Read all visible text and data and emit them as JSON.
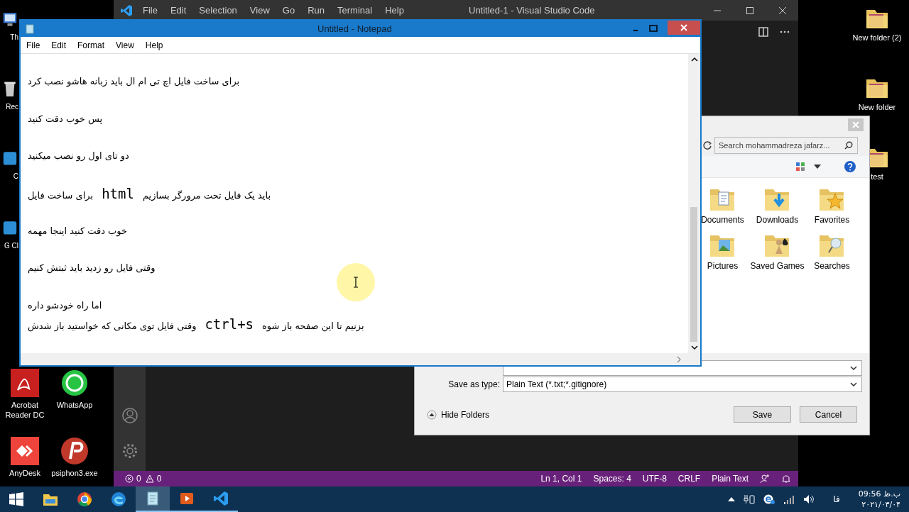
{
  "desktop": {
    "left_icons": [
      {
        "label": "Th",
        "kind": "computer"
      },
      {
        "label": "Rec",
        "kind": "bin"
      },
      {
        "label": "C",
        "kind": "app"
      },
      {
        "label": "G Cl",
        "kind": "app"
      }
    ],
    "bottom_icons": [
      {
        "label": "Acrobat Reader DC",
        "kind": "acrobat"
      },
      {
        "label": "WhatsApp",
        "kind": "whatsapp"
      },
      {
        "label": "AnyDesk",
        "kind": "anydesk"
      },
      {
        "label": "psiphon3.exe",
        "kind": "psiphon"
      }
    ],
    "right_icons": [
      {
        "label": "New folder (2)",
        "kind": "folder"
      },
      {
        "label": "New folder",
        "kind": "folder"
      },
      {
        "label": "test",
        "kind": "folder"
      }
    ]
  },
  "vscode": {
    "menu": [
      "File",
      "Edit",
      "Selection",
      "View",
      "Go",
      "Run",
      "Terminal",
      "Help"
    ],
    "title": "Untitled-1 - Visual Studio Code",
    "status_left": [
      {
        "kind": "error",
        "count": "0"
      },
      {
        "kind": "warning",
        "count": "0"
      }
    ],
    "status_right": [
      "Ln 1, Col 1",
      "Spaces: 4",
      "UTF-8",
      "CRLF",
      "Plain Text"
    ]
  },
  "save_dialog": {
    "search": {
      "placeholder": "Search mohammadreza jafarz..."
    },
    "folders": [
      {
        "label": "Documents",
        "kind": "documents"
      },
      {
        "label": "Downloads",
        "kind": "downloads"
      },
      {
        "label": "Favorites",
        "kind": "favorites"
      },
      {
        "label": "Pictures",
        "kind": "pictures"
      },
      {
        "label": "Saved Games",
        "kind": "games"
      },
      {
        "label": "Searches",
        "kind": "searches"
      }
    ],
    "save_as_type": {
      "label": "Save as type:",
      "value": "Plain Text (*.txt;*.gitignore)"
    },
    "hide_folders": "Hide Folders",
    "buttons": [
      "Save",
      "Cancel"
    ]
  },
  "notepad": {
    "title": "Untitled - Notepad",
    "menu": [
      "File",
      "Edit",
      "Format",
      "View",
      "Help"
    ],
    "lines": [
      {
        "kind": "blank"
      },
      {
        "kind": "text",
        "parts": [
          {
            "kind": "text",
            "text": "برای ساخت فایل اچ تی ام ال باید زبانه هاشو نصب کرد"
          }
        ]
      },
      {
        "kind": "blank"
      },
      {
        "kind": "text",
        "parts": [
          {
            "kind": "text",
            "text": "پس خوب دقت کنید"
          }
        ]
      },
      {
        "kind": "blank"
      },
      {
        "kind": "text",
        "parts": [
          {
            "kind": "text",
            "text": "دو تای اول رو نصب میکنید"
          }
        ]
      },
      {
        "kind": "blank"
      },
      {
        "kind": "text",
        "parts": [
          {
            "kind": "text",
            "text": "باید یک فایل تحت مرورگر بسازیم"
          },
          {
            "kind": "code",
            "text": "html"
          },
          {
            "kind": "text",
            "text": "برای ساخت فایل"
          }
        ]
      },
      {
        "kind": "blank"
      },
      {
        "kind": "text",
        "parts": [
          {
            "kind": "text",
            "text": "خوب دقت کنید اینجا مهمه"
          }
        ]
      },
      {
        "kind": "blank"
      },
      {
        "kind": "text",
        "parts": [
          {
            "kind": "text",
            "text": "وقتی فایل رو زدید باید ثبتش کنیم"
          }
        ]
      },
      {
        "kind": "blank"
      },
      {
        "kind": "text",
        "parts": [
          {
            "kind": "text",
            "text": "اما راه خودشو داره"
          }
        ]
      },
      {
        "kind": "text",
        "parts": [
          {
            "kind": "text",
            "text": "بزنیم تا این صفحه باز شوه"
          },
          {
            "kind": "code",
            "text": "ctrl+s"
          },
          {
            "kind": "text",
            "text": "وقتی فایل توی مکانی که خواستید باز شدش"
          }
        ]
      }
    ]
  },
  "taskbar": {
    "apps": [
      {
        "kind": "explorer",
        "open": false,
        "selected": false
      },
      {
        "kind": "chrome",
        "open": false,
        "selected": false
      },
      {
        "kind": "edge",
        "open": false,
        "selected": false
      },
      {
        "kind": "notepad",
        "open": true,
        "selected": true
      },
      {
        "kind": "media",
        "open": true,
        "selected": false
      },
      {
        "kind": "vscode",
        "open": true,
        "selected": false
      }
    ],
    "language": "فا",
    "time": "09:56 ب.ظ",
    "date": "۲۰۲۱/۰۳/۰۴"
  }
}
